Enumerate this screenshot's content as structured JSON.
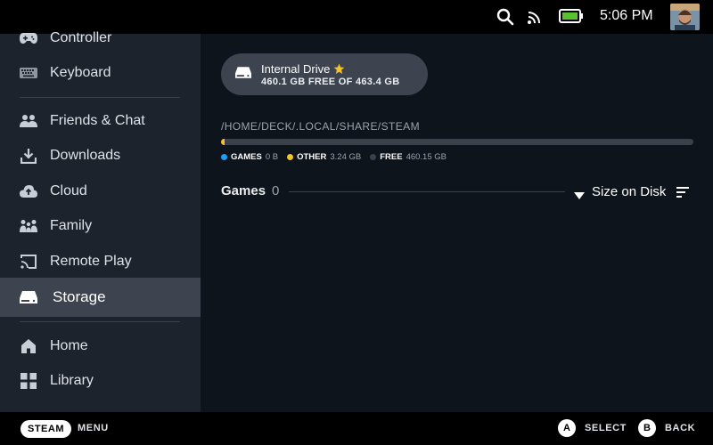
{
  "status": {
    "time": "5:06 PM"
  },
  "sidebar": {
    "items": [
      {
        "label": "Controller",
        "icon": "gamepad-icon"
      },
      {
        "label": "Keyboard",
        "icon": "keyboard-icon"
      },
      {
        "label": "Friends & Chat",
        "icon": "friends-icon"
      },
      {
        "label": "Downloads",
        "icon": "download-icon"
      },
      {
        "label": "Cloud",
        "icon": "cloud-icon"
      },
      {
        "label": "Family",
        "icon": "family-icon"
      },
      {
        "label": "Remote Play",
        "icon": "remote-play-icon"
      },
      {
        "label": "Storage",
        "icon": "drive-icon",
        "active": true
      },
      {
        "label": "Home",
        "icon": "home-icon"
      },
      {
        "label": "Library",
        "icon": "grid-icon"
      }
    ]
  },
  "storage": {
    "drive_name": "Internal Drive",
    "drive_free": "460.1 GB FREE OF 463.4 GB",
    "path": "/HOME/DECK/.LOCAL/SHARE/STEAM",
    "usage": {
      "games_fraction": 0.0,
      "other_fraction": 0.007
    },
    "legend": [
      {
        "label": "GAMES",
        "value": "0 B",
        "color": "#1a9fff"
      },
      {
        "label": "OTHER",
        "value": "3.24 GB",
        "color": "#f4c22d"
      },
      {
        "label": "FREE",
        "value": "460.15 GB",
        "color": "#3a414b"
      }
    ],
    "games_label": "Games",
    "games_count": "0",
    "sort_label": "Size on Disk"
  },
  "bottombar": {
    "steam_label": "STEAM",
    "menu_label": "MENU",
    "a_key": "A",
    "select_label": "SELECT",
    "b_key": "B",
    "back_label": "BACK"
  },
  "colors": {
    "accent_yellow": "#f4c22d",
    "active_bg": "#3d4450",
    "sidebar_bg": "#1d232c"
  }
}
